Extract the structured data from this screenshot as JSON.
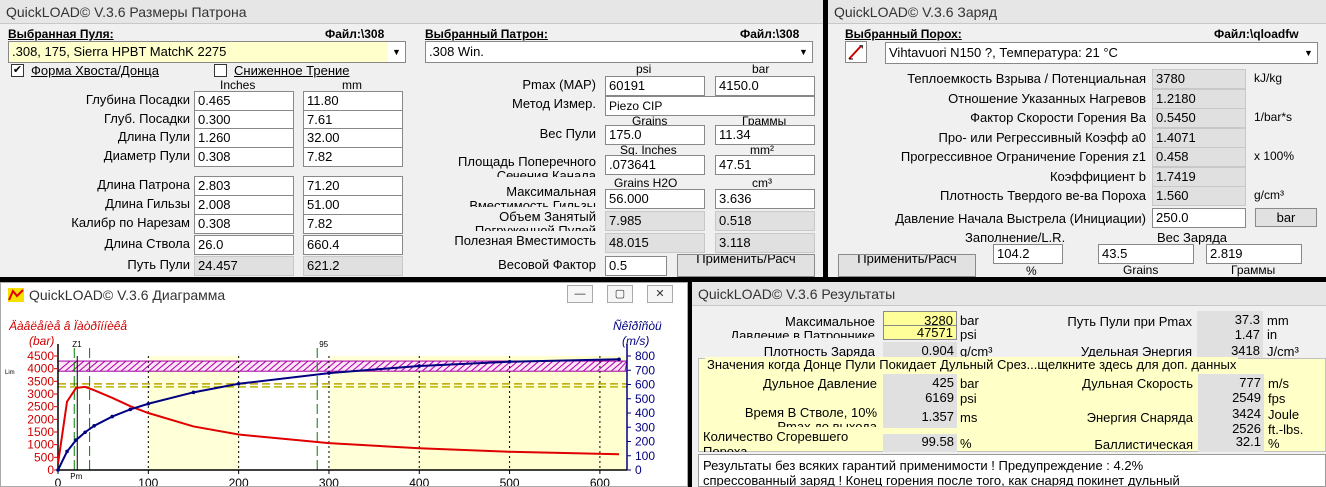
{
  "w1": {
    "title": "QuickLOAD© V.3.6 Размеры Патрона",
    "bullet_hdr": "Выбранная Пуля:",
    "bullet_file": "Файл:\\308",
    "bullet": ".308, 175, Sierra HPBT MatchK 2275",
    "cart_hdr": "Выбранный Патрон:",
    "cart_file": "Файл:\\308",
    "cart": ".308 Win.",
    "cb1": "Форма Хвоста/Донца",
    "cb2": "Сниженное Трение",
    "u_in": "Inches",
    "u_mm": "mm",
    "u_psi": "psi",
    "u_bar": "bar",
    "rows": [
      {
        "label": "Глубина Посадки",
        "in": "0.465",
        "mm": "11.80"
      },
      {
        "label": "Глуб. Посадки",
        "in": "0.300",
        "mm": "7.61"
      },
      {
        "label": "Длина Пули",
        "in": "1.260",
        "mm": "32.00"
      },
      {
        "label": "Диаметр Пули",
        "in": "0.308",
        "mm": "7.82"
      },
      {
        "label": "Длина Патрона",
        "in": "2.803",
        "mm": "71.20"
      },
      {
        "label": "Длина Гильзы",
        "in": "2.008",
        "mm": "51.00"
      },
      {
        "label": "Калибр по Нарезам",
        "in": "0.308",
        "mm": "7.82"
      },
      {
        "label": "Длина Ствола",
        "in": "26.0",
        "mm": "660.4"
      },
      {
        "label": "Путь Пули",
        "in": "24.457",
        "mm": "621.2"
      }
    ],
    "pmax_l": "Pmax (MAP)",
    "pmax_psi": "60191",
    "pmax_bar": "4150.0",
    "meth_l": "Метод Измер.",
    "meth": "Piezo CIP",
    "u_grains": "Grains",
    "u_gramm": "Граммы",
    "wt_l": "Вес Пули",
    "wt_gr": "175.0",
    "wt_g": "11.34",
    "u_sqin": "Sq. Inches",
    "u_mm2": "mm²",
    "area_l": "Площадь Поперечного",
    "area_l2": "Сечения Канала",
    "area_in": ".073641",
    "area_mm": "47.51",
    "u_grh2o": "Grains H2O",
    "u_cm3": "cm³",
    "cap_l": "Максимальная",
    "cap_l2": "Вместимость Гильзы",
    "cap_gr": "56.000",
    "cap_cm": "3.636",
    "occ_l": "Объем Занятый",
    "occ_l2": "Погруженной Пулей",
    "occ_gr": "7.985",
    "occ_cm": "0.518",
    "use_l": "Полезная Вместимость",
    "use_gr": "48.015",
    "use_cm": "3.118",
    "wf_l": "Весовой Фактор",
    "wf": "0.5",
    "apply": "Применить/Расч"
  },
  "w2": {
    "title": "QuickLOAD© V.3.6 Заряд",
    "pw_hdr": "Выбранный Порох:",
    "pw_file": "Файл:\\qloadfw",
    "powder": "Vihtavuori N150 ?, Температура: 21 °C",
    "rows": [
      {
        "label": "Теплоемкость Взрыва / Потенциальная",
        "val": "3780",
        "unit": "kJ/kg"
      },
      {
        "label": "Отношение Указанных Нагревов",
        "val": "1.2180",
        "unit": ""
      },
      {
        "label": "Фактор Скорости Горения  Ba",
        "val": "0.5450",
        "unit": "1/bar*s"
      },
      {
        "label": "Про- или Регрессивный Коэфф  a0",
        "val": "1.4071",
        "unit": ""
      },
      {
        "label": "Прогрессивное Ограничение Горения z1",
        "val": "0.458",
        "unit": "x 100%"
      },
      {
        "label": "Коэффициент b",
        "val": "1.7419",
        "unit": ""
      },
      {
        "label": "Плотность Твердого ве-ва Пороха",
        "val": "1.560",
        "unit": "g/cm³"
      }
    ],
    "ign_l": "Давление Начала Выстрела (Инициации)",
    "ign": "250.0",
    "ign_unit": "bar",
    "fill_l": "Заполнение/L.R.",
    "fill": "104.2",
    "fill_u": "%",
    "chg_l": "Вес Заряда",
    "chg_gr": "43.5",
    "chg_gr_u": "Grains",
    "chg_g": "2.819",
    "chg_g_u": "Граммы",
    "apply": "Применить/Расч"
  },
  "w3": {
    "title": "QuickLOAD© V.3.6 Диаграмма",
    "ylabel_l": "Äàâëåíèå â Ïàòðîííèêå",
    "yunit_l": "(bar)",
    "ylabel_r": "Ñêîðîñòü",
    "yunit_r": "(m/s)",
    "mk_z1": "Z1",
    "mk_95": "95",
    "mk_pm": "Pm",
    "mk_lim": "Lim"
  },
  "chart_data": {
    "type": "line",
    "x": [
      0,
      10,
      20,
      30,
      40,
      60,
      80,
      100,
      150,
      200,
      300,
      400,
      500,
      621.2
    ],
    "xlim": [
      0,
      630
    ],
    "xticks": [
      0,
      100,
      200,
      300,
      400,
      500,
      600
    ],
    "ylim_left": [
      0,
      4500
    ],
    "yticks_left": [
      0,
      500,
      1000,
      1500,
      2000,
      2500,
      3000,
      3500,
      4000,
      4500
    ],
    "ylim_right": [
      0,
      800
    ],
    "yticks_right": [
      0,
      100,
      200,
      300,
      400,
      500,
      600,
      700,
      800
    ],
    "series": [
      {
        "axis": "left",
        "color": "#e00000",
        "values": [
          250,
          2700,
          3240,
          3280,
          3150,
          2850,
          2520,
          2250,
          1720,
          1400,
          1060,
          860,
          720,
          620
        ]
      },
      {
        "axis": "right",
        "color": "#000080",
        "values": [
          0,
          130,
          210,
          265,
          310,
          375,
          425,
          465,
          545,
          605,
          680,
          730,
          760,
          777
        ]
      }
    ],
    "markers_x": [
      18,
      35,
      287
    ],
    "pmax_band": [
      3900,
      4300
    ],
    "hlines_left": [
      3400,
      3280
    ]
  },
  "w4": {
    "title": "QuickLOAD© V.3.6 Результаты",
    "maxp_l": "Максимальное",
    "maxp_l2": "Давление в Патроннике",
    "maxp_bar": "3280",
    "maxp_psi": "47571",
    "u_bar": "bar",
    "u_psi": "psi",
    "travel_l": "Путь Пули при Pmax",
    "travel_mm": "37.3",
    "travel_in": "1.47",
    "u_mm": "mm",
    "u_in": "in",
    "dens_l": "Плотность Заряда",
    "dens": "0.904",
    "dens_u": "g/cm³",
    "en_l": "Удельная Энергия",
    "en": "3418",
    "en_u": "J/cm³",
    "section": "Значения когда Донце Пули Покидает Дульный Срез...щелкните здесь для доп. данных",
    "mp_l": "Дульное Давление",
    "mp_bar": "425",
    "mp_psi": "6169",
    "mv_l": "Дульная Скорость",
    "mv_ms": "777",
    "mv_fps": "2549",
    "u_ms": "m/s",
    "u_fps": "fps",
    "time_l": "Время В Стволе, 10%",
    "time_l2": "Pmax до выхода",
    "time": "1.357",
    "time_u": "ms",
    "me_l": "Энергия Снаряда",
    "me_j": "3424",
    "me_ft": "2526",
    "u_j": "Joule",
    "u_ft": "ft.-lbs.",
    "burn_l": "Количество Сгоревшего",
    "burn_l2": "Пороха",
    "burn": "99.58",
    "burn_u": "%",
    "eff_l": "Баллистическая",
    "eff": "32.1",
    "eff_u": "%",
    "msg1": "Результаты без всяких гарантий применимости !  Предупреждение : 4.2%",
    "msg2": "спрессованный заряд ! Конец горения после того, как снаряд покинет дульный"
  }
}
